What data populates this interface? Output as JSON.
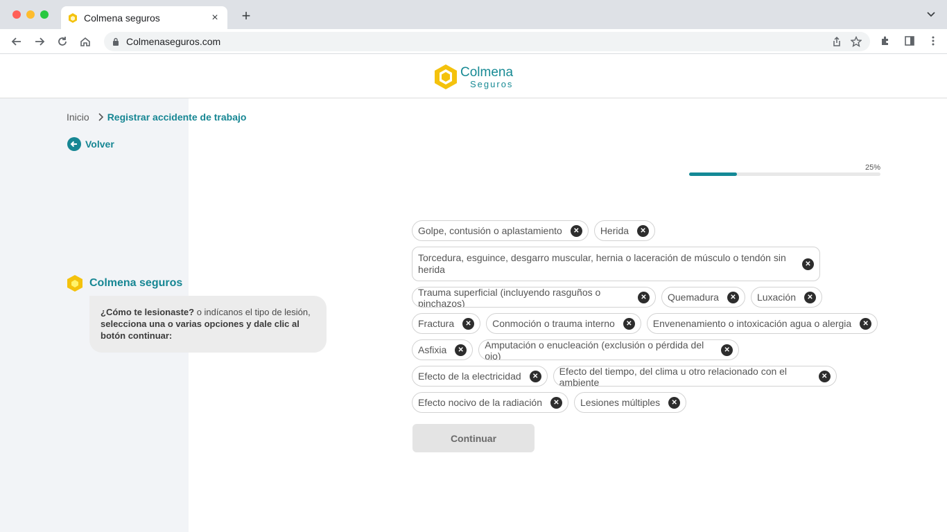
{
  "browser": {
    "tab_title": "Colmena seguros",
    "url": "Colmenaseguros.com"
  },
  "brand": {
    "name_line1": "Colmena",
    "name_line2": "Seguros",
    "accent": "#168693",
    "logo_yellow": "#f4c20d"
  },
  "breadcrumb": {
    "home": "Inicio",
    "current": "Registrar accidente de trabajo"
  },
  "back_label": "Volver",
  "progress": {
    "label": "25%",
    "fraction": 0.25
  },
  "bot": {
    "name": "Colmena seguros",
    "msg_bold1": "¿Cómo te lesionaste?",
    "msg_plain": " o indícanos el tipo de lesión, ",
    "msg_bold2": "selecciona una o varias opciones y dale clic al botón continuar:"
  },
  "options": [
    "Golpe, contusión o aplastamiento",
    "Herida",
    "Torcedura, esguince, desgarro muscular, hernia o laceración de músculo o tendón sin herida",
    "Trauma superficial (incluyendo rasguños o pinchazos)",
    "Quemadura",
    "Luxación",
    "Fractura",
    "Conmoción o trauma interno",
    "Envenenamiento o intoxicación agua o alergia",
    "Asfixia",
    "Amputación o enucleación (exclusión o pérdida del ojo)",
    "Efecto de la electricidad",
    "Efecto del tiempo, del clima u otro relacionado con el ambiente",
    "Efecto nocivo de la radiación",
    "Lesiones múltiples"
  ],
  "continue_label": "Continuar"
}
